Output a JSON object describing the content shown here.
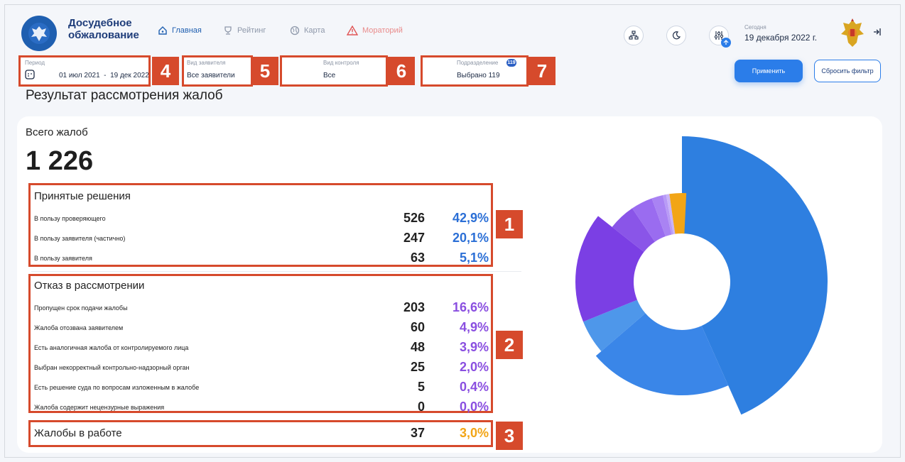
{
  "header": {
    "brand_line1": "Досудебное",
    "brand_line2": "обжалование",
    "nav": [
      {
        "label": "Главная",
        "icon": "home-icon",
        "state": "active"
      },
      {
        "label": "Рейтинг",
        "icon": "trophy-icon",
        "state": "normal"
      },
      {
        "label": "Карта",
        "icon": "globe-icon",
        "state": "normal"
      },
      {
        "label": "Мораторий",
        "icon": "warning-icon",
        "state": "danger"
      }
    ],
    "today_label": "Сегодня",
    "today_date": "19 декабря 2022 г."
  },
  "filters": {
    "period_label": "Период",
    "period_value": "01 июл 2021  -  19 дек 2022",
    "applicant_label": "Вид заявителя",
    "applicant_value": "Все заявители",
    "control_label": "Вид контроля",
    "control_value": "Все",
    "division_label": "Подразделение",
    "division_count": "119",
    "division_value": "Выбрано 119",
    "apply_label": "Применить",
    "reset_label": "Сбросить фильтр"
  },
  "badges": {
    "b1": "1",
    "b2": "2",
    "b3": "3",
    "b4": "4",
    "b5": "5",
    "b6": "6",
    "b7": "7"
  },
  "page_title": "Результат рассмотрения жалоб",
  "summary": {
    "total_label": "Всего жалоб",
    "total_value": "1 226"
  },
  "decisions": {
    "title": "Принятые решения",
    "rows": [
      {
        "label": "В пользу проверяющего",
        "count": "526",
        "pct": "42,9%"
      },
      {
        "label": "В пользу заявителя (частично)",
        "count": "247",
        "pct": "20,1%"
      },
      {
        "label": "В пользу заявителя",
        "count": "63",
        "pct": "5,1%"
      }
    ]
  },
  "refusals": {
    "title": "Отказ в рассмотрении",
    "rows": [
      {
        "label": "Пропущен срок подачи жалобы",
        "count": "203",
        "pct": "16,6%"
      },
      {
        "label": "Жалоба отозвана заявителем",
        "count": "60",
        "pct": "4,9%"
      },
      {
        "label": "Есть аналогичная жалоба от контролируемого лица",
        "count": "48",
        "pct": "3,9%"
      },
      {
        "label": "Выбран некорректный контрольно-надзорный орган",
        "count": "25",
        "pct": "2,0%"
      },
      {
        "label": "Есть решение суда по вопросам изложенным в жалобе",
        "count": "5",
        "pct": "0,4%"
      },
      {
        "label": "Жалоба содержит нецензурные выражения",
        "count": "0",
        "pct": "0,0%"
      }
    ]
  },
  "in_work": {
    "label": "Жалобы в работе",
    "count": "37",
    "pct": "3,0%"
  },
  "colors": {
    "accent": "#2b7de9",
    "blue_pct": "#2b6fd6",
    "purple_pct": "#8a4fe0",
    "orange_pct": "#f2a516",
    "badge": "#d64a2c"
  },
  "chart_data": {
    "type": "pie",
    "variant": "variable-radius donut",
    "categories": [
      "В пользу проверяющего",
      "В пользу заявителя (частично)",
      "В пользу заявителя",
      "Пропущен срок подачи жалобы",
      "Жалоба отозвана заявителем",
      "Есть аналогичная жалоба от контролируемого лица",
      "Выбран некорректный контрольно-надзорный орган",
      "Есть решение суда по вопросам изложенным в жалобе",
      "Жалоба содержит нецензурные выражения",
      "Жалобы в работе"
    ],
    "values": [
      526,
      247,
      63,
      203,
      60,
      48,
      25,
      5,
      0,
      37
    ],
    "colors": [
      "#2e7fe0",
      "#3a86e8",
      "#4e97ea",
      "#7b3fe4",
      "#8a55e8",
      "#9a6cf0",
      "#a983f3",
      "#b89bf6",
      "#c9b3f8",
      "#f2a516"
    ]
  }
}
